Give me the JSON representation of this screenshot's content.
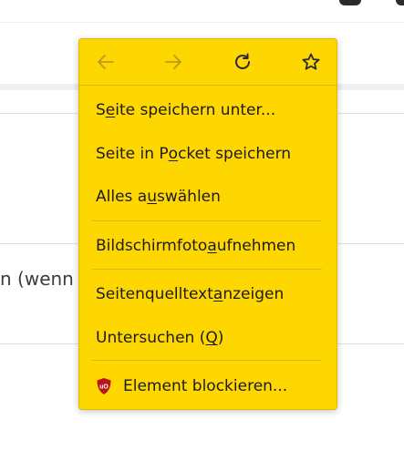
{
  "colors": {
    "menu_background": "#ffd700",
    "menu_text": "#1c1b22",
    "disabled_icon": "#b89a20",
    "active_icon": "#2b2a33",
    "ublock_red": "#b8141a"
  },
  "background": {
    "partial_text": "n (wenn e"
  },
  "nav": {
    "back_icon": "arrow-left-icon",
    "forward_icon": "arrow-right-icon",
    "reload_icon": "reload-icon",
    "bookmark_icon": "star-icon"
  },
  "menu": {
    "items": [
      {
        "pre": "S",
        "ul": "e",
        "post": "ite speichern unter..."
      },
      {
        "pre": "Seite in P",
        "ul": "o",
        "post": "cket speichern"
      },
      {
        "pre": "Alles a",
        "ul": "u",
        "post": "swählen"
      },
      {
        "pre": "Bildschirmfoto ",
        "ul": "a",
        "post": "ufnehmen"
      },
      {
        "pre": "Seitenquelltext ",
        "ul": "a",
        "post": "nzeigen"
      },
      {
        "pre": "Untersuchen (",
        "ul": "Q",
        "post": ")"
      },
      {
        "icon": "ublock-origin-icon",
        "label": "Element blockieren..."
      }
    ]
  }
}
